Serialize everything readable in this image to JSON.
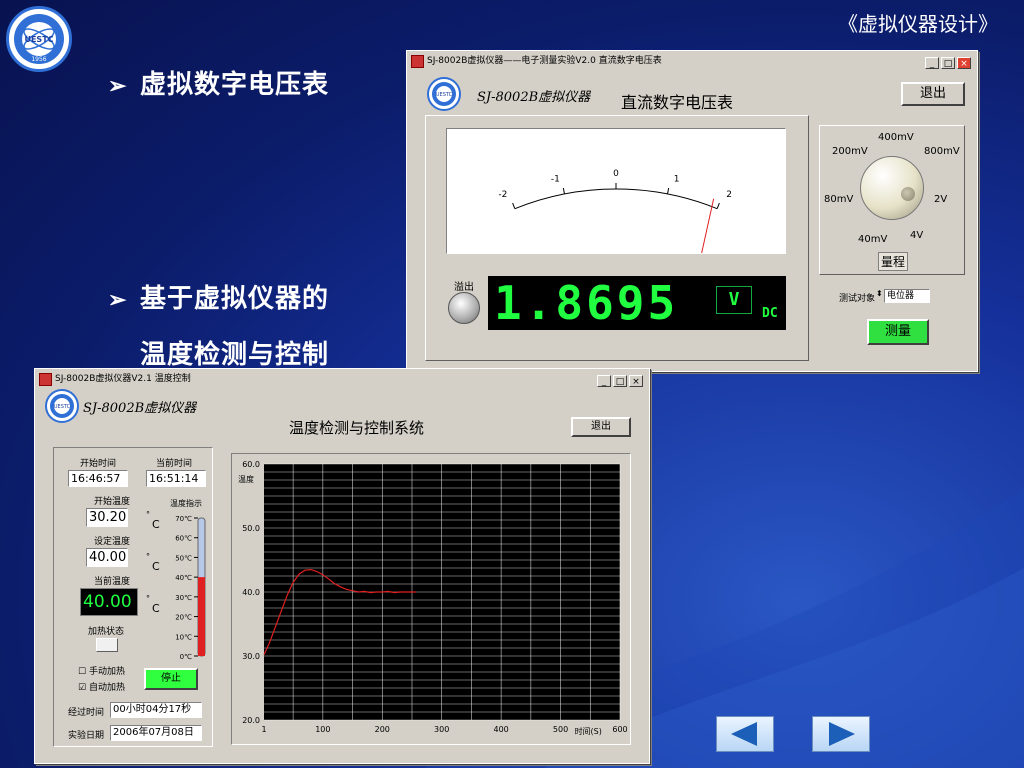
{
  "slide": {
    "title": "《虚拟仪器设计》",
    "bullet1": "虚拟数字电压表",
    "bullet2": "基于虚拟仪器的",
    "bullet3": "温度检测与控制",
    "bullet_icon": "arrow-bullet-icon",
    "logo_text": "UESTC",
    "logo_year": "1956",
    "nav_prev": "previous-triangle-icon",
    "nav_next": "next-triangle-icon"
  },
  "voltmeter": {
    "window_title": "SJ-8002B虚拟仪器——电子测量实验V2.0  直流数字电压表",
    "brand": "SJ-8002B虚拟仪器",
    "title": "直流数字电压表",
    "exit_label": "退出",
    "meter_labels": [
      "-2",
      "-1",
      "0",
      "1",
      "2"
    ],
    "meter_value": 1.8695,
    "overflow_label": "溢出",
    "display_value": "1.8695",
    "unit": "V",
    "mode": "DC",
    "ranges": [
      "200mV",
      "400mV",
      "800mV",
      "80mV",
      "2V",
      "40mV",
      "4V"
    ],
    "range_label": "量程",
    "measure_target_label": "测试对象",
    "measure_target_value": "电位器",
    "measure_button": "测量"
  },
  "thermo": {
    "window_title": "SJ-8002B虚拟仪器V2.1  温度控制",
    "brand": "SJ-8002B虚拟仪器",
    "title": "温度检测与控制系统",
    "exit_label": "退出",
    "start_time_label": "开始时间",
    "start_time": "16:46:57",
    "current_time_label": "当前时间",
    "current_time": "16:51:14",
    "start_temp_label": "开始温度",
    "start_temp": "30.20",
    "set_temp_label": "设定温度",
    "set_temp": "40.00",
    "current_temp_label": "当前温度",
    "current_temp": "40.00",
    "unit_c": "C",
    "deg": "°",
    "indicator_label": "温度指示",
    "indicator_ticks": [
      "70℃",
      "60℃",
      "50℃",
      "40℃",
      "30℃",
      "20℃",
      "10℃",
      "0℃"
    ],
    "indicator_level": 40,
    "heat_status_label": "加热状态",
    "manual_heat_label": "手动加热",
    "auto_heat_label": "自动加热",
    "stop_button": "停止",
    "elapsed_label": "经过时间",
    "elapsed": "00小时04分17秒",
    "date_label": "实验日期",
    "date": "2006年07月08日"
  },
  "chart_data": {
    "type": "line",
    "ylabel": "温度",
    "xlabel": "时间(S)",
    "xlim": [
      1,
      600
    ],
    "ylim": [
      20,
      60
    ],
    "x_ticks": [
      "1",
      "100",
      "200",
      "300",
      "400",
      "500",
      "600"
    ],
    "y_ticks": [
      "20.0",
      "30.0",
      "40.0",
      "50.0",
      "60.0"
    ],
    "grid": true,
    "series": [
      {
        "color": "#e02020",
        "x": [
          1,
          10,
          20,
          30,
          40,
          50,
          60,
          70,
          80,
          90,
          100,
          110,
          120,
          130,
          140,
          150,
          160,
          170,
          180,
          190,
          200,
          210,
          220,
          230,
          240,
          250,
          257
        ],
        "y": [
          30.2,
          32.0,
          34.5,
          37.0,
          39.5,
          41.5,
          42.8,
          43.4,
          43.5,
          43.2,
          42.7,
          42.0,
          41.3,
          40.8,
          40.4,
          40.2,
          40.0,
          40.1,
          39.9,
          40.0,
          40.0,
          40.1,
          39.9,
          40.0,
          40.0,
          40.0,
          40.0
        ]
      }
    ]
  }
}
